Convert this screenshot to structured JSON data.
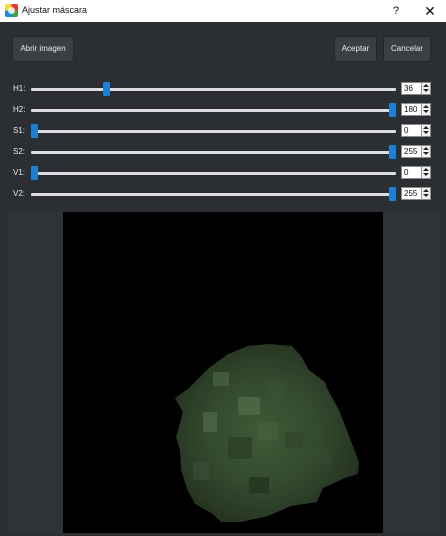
{
  "window": {
    "title": "Ajustar máscara",
    "help_label": "?",
    "close_label": "✕"
  },
  "toolbar": {
    "open_image_label": "Abrir imagen",
    "accept_label": "Aceptar",
    "cancel_label": "Cancelar"
  },
  "sliders": [
    {
      "label": "H1:",
      "value": "36",
      "min": 0,
      "max": 180
    },
    {
      "label": "H2:",
      "value": "180",
      "min": 0,
      "max": 180
    },
    {
      "label": "S1:",
      "value": "0",
      "min": 0,
      "max": 255
    },
    {
      "label": "S2:",
      "value": "255",
      "min": 0,
      "max": 255
    },
    {
      "label": "V1:",
      "value": "0",
      "min": 0,
      "max": 255
    },
    {
      "label": "V2:",
      "value": "255",
      "min": 0,
      "max": 255
    }
  ],
  "colors": {
    "accent": "#1e7fd6",
    "background": "#2b2e33",
    "canvas": "#000000"
  },
  "icons": {
    "app": "app-logo-icon",
    "close": "close-icon",
    "help": "help-icon"
  }
}
